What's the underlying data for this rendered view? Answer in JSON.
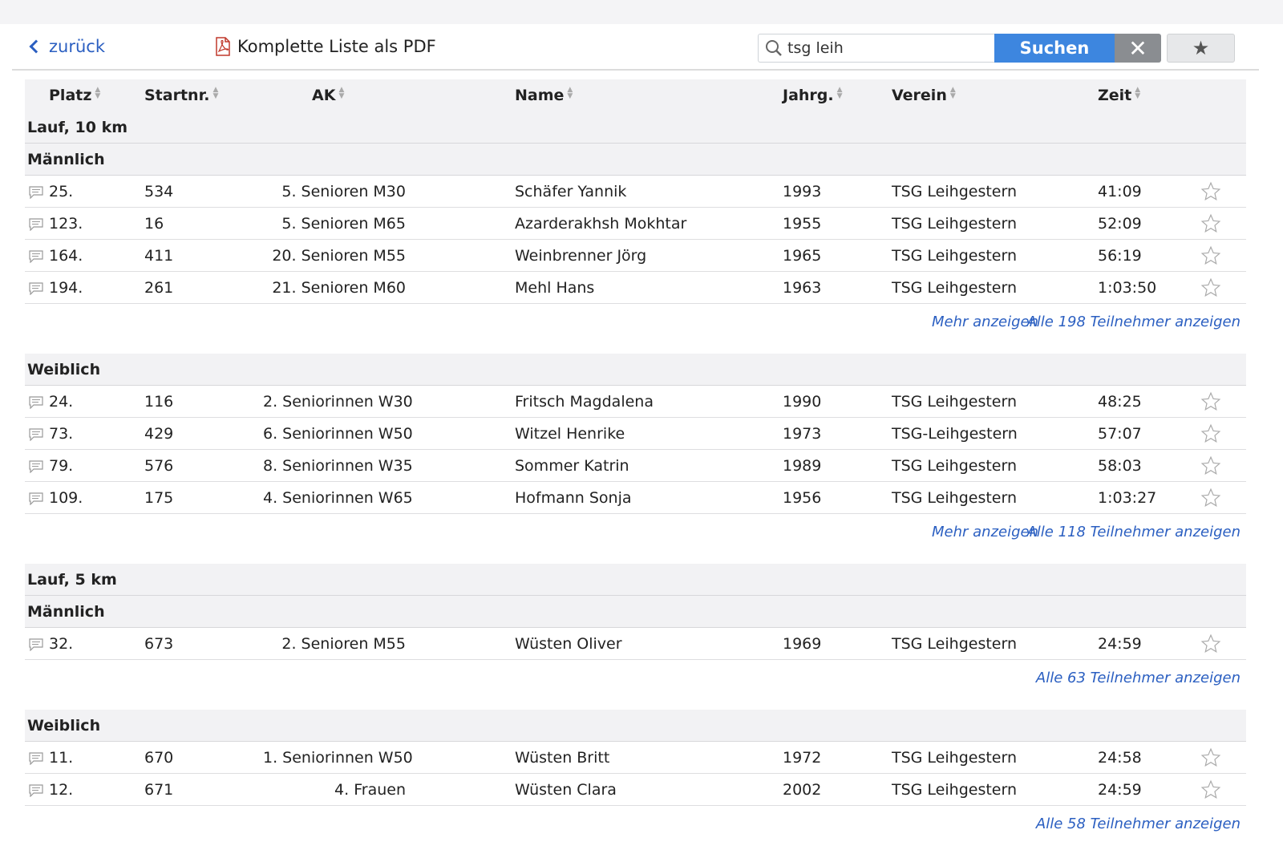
{
  "toolbar": {
    "back_label": "zurück",
    "pdf_label": "Komplette Liste als PDF",
    "search_value": "tsg leih",
    "search_button": "Suchen",
    "clear_button": "✕",
    "favorites_button": "★"
  },
  "columns": {
    "place": "Platz",
    "startnr": "Startnr.",
    "ak": "AK",
    "name": "Name",
    "jahrg": "Jahrg.",
    "verein": "Verein",
    "zeit": "Zeit"
  },
  "sections": [
    {
      "title": "Lauf, 10 km",
      "groups": [
        {
          "title": "Männlich",
          "rows": [
            {
              "place": "25.",
              "startnr": "534",
              "ak": "5. Senioren M30",
              "name": "Schäfer Yannik",
              "jahrg": "1993",
              "verein": "TSG Leihgestern",
              "zeit": "41:09"
            },
            {
              "place": "123.",
              "startnr": "16",
              "ak": "5. Senioren M65",
              "name": "Azarderakhsh Mokhtar",
              "jahrg": "1955",
              "verein": "TSG Leihgestern",
              "zeit": "52:09"
            },
            {
              "place": "164.",
              "startnr": "411",
              "ak": "20. Senioren M55",
              "name": "Weinbrenner Jörg",
              "jahrg": "1965",
              "verein": "TSG Leihgestern",
              "zeit": "56:19"
            },
            {
              "place": "194.",
              "startnr": "261",
              "ak": "21. Senioren M60",
              "name": "Mehl Hans",
              "jahrg": "1963",
              "verein": "TSG Leihgestern",
              "zeit": "1:03:50"
            }
          ],
          "more": "Mehr anzeigen",
          "all": "Alle 198 Teilnehmer anzeigen"
        },
        {
          "title": "Weiblich",
          "rows": [
            {
              "place": "24.",
              "startnr": "116",
              "ak": "2. Seniorinnen W30",
              "name": "Fritsch Magdalena",
              "jahrg": "1990",
              "verein": "TSG Leihgestern",
              "zeit": "48:25"
            },
            {
              "place": "73.",
              "startnr": "429",
              "ak": "6. Seniorinnen W50",
              "name": "Witzel Henrike",
              "jahrg": "1973",
              "verein": "TSG-Leihgestern",
              "zeit": "57:07"
            },
            {
              "place": "79.",
              "startnr": "576",
              "ak": "8. Seniorinnen W35",
              "name": "Sommer Katrin",
              "jahrg": "1989",
              "verein": "TSG Leihgestern",
              "zeit": "58:03"
            },
            {
              "place": "109.",
              "startnr": "175",
              "ak": "4. Seniorinnen W65",
              "name": "Hofmann Sonja",
              "jahrg": "1956",
              "verein": "TSG Leihgestern",
              "zeit": "1:03:27"
            }
          ],
          "more": "Mehr anzeigen",
          "all": "Alle 118 Teilnehmer anzeigen"
        }
      ]
    },
    {
      "title": "Lauf, 5 km",
      "groups": [
        {
          "title": "Männlich",
          "rows": [
            {
              "place": "32.",
              "startnr": "673",
              "ak": "2. Senioren M55",
              "name": "Wüsten Oliver",
              "jahrg": "1969",
              "verein": "TSG Leihgestern",
              "zeit": "24:59"
            }
          ],
          "more": "",
          "all": "Alle 63 Teilnehmer anzeigen"
        },
        {
          "title": "Weiblich",
          "rows": [
            {
              "place": "11.",
              "startnr": "670",
              "ak": "1. Seniorinnen W50",
              "name": "Wüsten Britt",
              "jahrg": "1972",
              "verein": "TSG Leihgestern",
              "zeit": "24:58"
            },
            {
              "place": "12.",
              "startnr": "671",
              "ak": "4. Frauen",
              "name": "Wüsten Clara",
              "jahrg": "2002",
              "verein": "TSG Leihgestern",
              "zeit": "24:59"
            }
          ],
          "more": "",
          "all": "Alle 58 Teilnehmer anzeigen"
        }
      ]
    }
  ],
  "colors": {
    "accent": "#3d86df",
    "link": "#2b5fc1",
    "header_bg": "#f2f2f4"
  }
}
